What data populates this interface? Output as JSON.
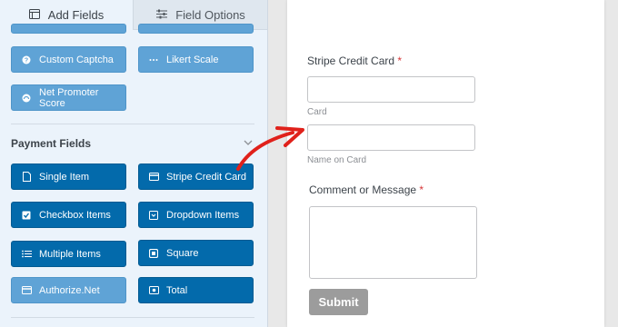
{
  "tabs": {
    "add_fields": "Add Fields",
    "field_options": "Field Options"
  },
  "fields_top": [
    {
      "label": "Custom Captcha",
      "icon": "captcha-icon"
    },
    {
      "label": "Likert Scale",
      "icon": "likert-icon"
    },
    {
      "label": "Net Promoter Score",
      "icon": "gauge-icon"
    }
  ],
  "payment_section": {
    "title": "Payment Fields",
    "fields": [
      {
        "label": "Single Item",
        "icon": "file-icon"
      },
      {
        "label": "Stripe Credit Card",
        "icon": "credit-card-icon"
      },
      {
        "label": "Checkbox Items",
        "icon": "checkbox-icon"
      },
      {
        "label": "Dropdown Items",
        "icon": "dropdown-icon"
      },
      {
        "label": "Multiple Items",
        "icon": "list-icon"
      },
      {
        "label": "Square",
        "icon": "square-icon"
      },
      {
        "label": "Authorize.Net",
        "icon": "credit-card-icon"
      },
      {
        "label": "Total",
        "icon": "money-icon"
      }
    ]
  },
  "form": {
    "stripe_label": "Stripe Credit Card",
    "required_mark": "*",
    "card_sublabel": "Card",
    "name_sublabel": "Name on Card",
    "comment_label": "Comment or Message",
    "submit_label": "Submit"
  },
  "colors": {
    "accent": "#036aab",
    "accent_light": "#5fa3d6",
    "arrow": "#e0211b",
    "required": "#d63638"
  }
}
